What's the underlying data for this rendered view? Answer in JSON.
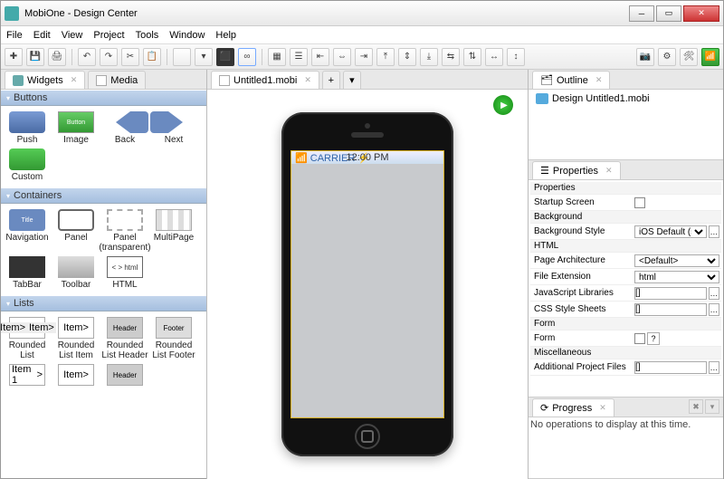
{
  "window": {
    "title": "MobiOne - Design Center"
  },
  "menus": [
    "File",
    "Edit",
    "View",
    "Project",
    "Tools",
    "Window",
    "Help"
  ],
  "left_tabs": [
    {
      "label": "Widgets",
      "active": true
    },
    {
      "label": "Media",
      "active": false
    }
  ],
  "widget_sections": {
    "buttons": {
      "title": "Buttons",
      "items": [
        "Push",
        "Image",
        "Back",
        "Next",
        "Custom"
      ]
    },
    "containers": {
      "title": "Containers",
      "items": [
        "Navigation",
        "Panel",
        "Panel (transparent)",
        "MultiPage",
        "TabBar",
        "Toolbar",
        "HTML"
      ]
    },
    "lists": {
      "title": "Lists",
      "items": [
        "Rounded List",
        "Rounded List Item",
        "Rounded List Header",
        "Rounded List Footer"
      ]
    }
  },
  "preview_labels": {
    "image_btn": "Button",
    "nav_title": "Title",
    "html_code": "< > html",
    "item": "Item",
    "item1": "Item 1",
    "header": "Header",
    "footer": "Footer",
    "arrow": ">"
  },
  "editor": {
    "file_tab": "Untitled1.mobi",
    "status_carrier": "CARRIER",
    "status_time": "12:00 PM"
  },
  "outline": {
    "tab": "Outline",
    "root": "Design Untitled1.mobi"
  },
  "properties": {
    "tab": "Properties",
    "groups": {
      "properties": "Properties",
      "background": "Background",
      "html": "HTML",
      "form": "Form",
      "misc": "Miscellaneous"
    },
    "rows": {
      "startup": {
        "label": "Startup Screen"
      },
      "bg_style": {
        "label": "Background Style",
        "value": "iOS Default (strip..."
      },
      "page_arch": {
        "label": "Page Architecture",
        "value": "<Default>"
      },
      "file_ext": {
        "label": "File Extension",
        "value": "html"
      },
      "js_libs": {
        "label": "JavaScript Libraries",
        "value": "[]"
      },
      "css": {
        "label": "CSS Style Sheets",
        "value": "[]"
      },
      "form": {
        "label": "Form"
      },
      "extra": {
        "label": "Additional Project Files",
        "value": "[]"
      }
    }
  },
  "progress": {
    "tab": "Progress",
    "message": "No operations to display at this time."
  }
}
